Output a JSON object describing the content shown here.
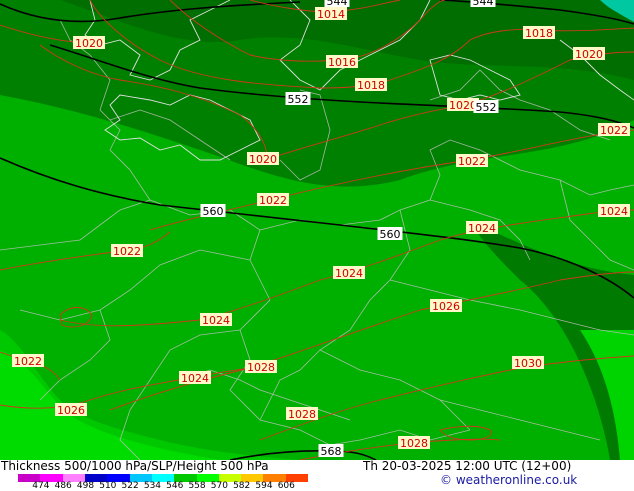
{
  "map": {
    "isobar_labels": [
      {
        "text": "1014",
        "color": "#cc0000"
      },
      {
        "text": "1016",
        "color": "#cc0000"
      },
      {
        "text": "1018",
        "color": "#cc0000"
      },
      {
        "text": "1018",
        "color": "#cc0000"
      },
      {
        "text": "1020",
        "color": "#cc0000"
      },
      {
        "text": "1020",
        "color": "#cc0000"
      },
      {
        "text": "1020",
        "color": "#cc0000"
      },
      {
        "text": "1020",
        "color": "#cc0000"
      },
      {
        "text": "1022",
        "color": "#cc0000"
      },
      {
        "text": "1022",
        "color": "#cc0000"
      },
      {
        "text": "1022",
        "color": "#cc0000"
      },
      {
        "text": "1022",
        "color": "#cc0000"
      },
      {
        "text": "1022",
        "color": "#cc0000"
      },
      {
        "text": "1024",
        "color": "#cc0000"
      },
      {
        "text": "1024",
        "color": "#cc0000"
      },
      {
        "text": "1024",
        "color": "#cc0000"
      },
      {
        "text": "1024",
        "color": "#cc0000"
      },
      {
        "text": "1024",
        "color": "#cc0000"
      },
      {
        "text": "1026",
        "color": "#cc0000"
      },
      {
        "text": "1026",
        "color": "#cc0000"
      },
      {
        "text": "1028",
        "color": "#cc0000"
      },
      {
        "text": "1028",
        "color": "#cc0000"
      },
      {
        "text": "1028",
        "color": "#cc0000"
      },
      {
        "text": "1030",
        "color": "#cc0000"
      }
    ],
    "height_labels": [
      "544",
      "544",
      "552",
      "552",
      "560",
      "560",
      "568"
    ]
  },
  "footer": {
    "title": "Thickness 500/1000 hPa/SLP/Height 500 hPa",
    "datetime": "Th 20-03-2025 12:00 UTC (12+00)",
    "credit": "© weatheronline.co.uk",
    "legend": {
      "ticks": [
        "474",
        "486",
        "498",
        "510",
        "522",
        "534",
        "546",
        "558",
        "570",
        "582",
        "594",
        "606"
      ],
      "colors": [
        "#c800c8",
        "#ff00ff",
        "#ff80ff",
        "#0000c8",
        "#0000ff",
        "#00c8ff",
        "#00ffff",
        "#00c800",
        "#00ff00",
        "#c8ff00",
        "#ffc800",
        "#ff8000",
        "#ff4000"
      ]
    }
  }
}
